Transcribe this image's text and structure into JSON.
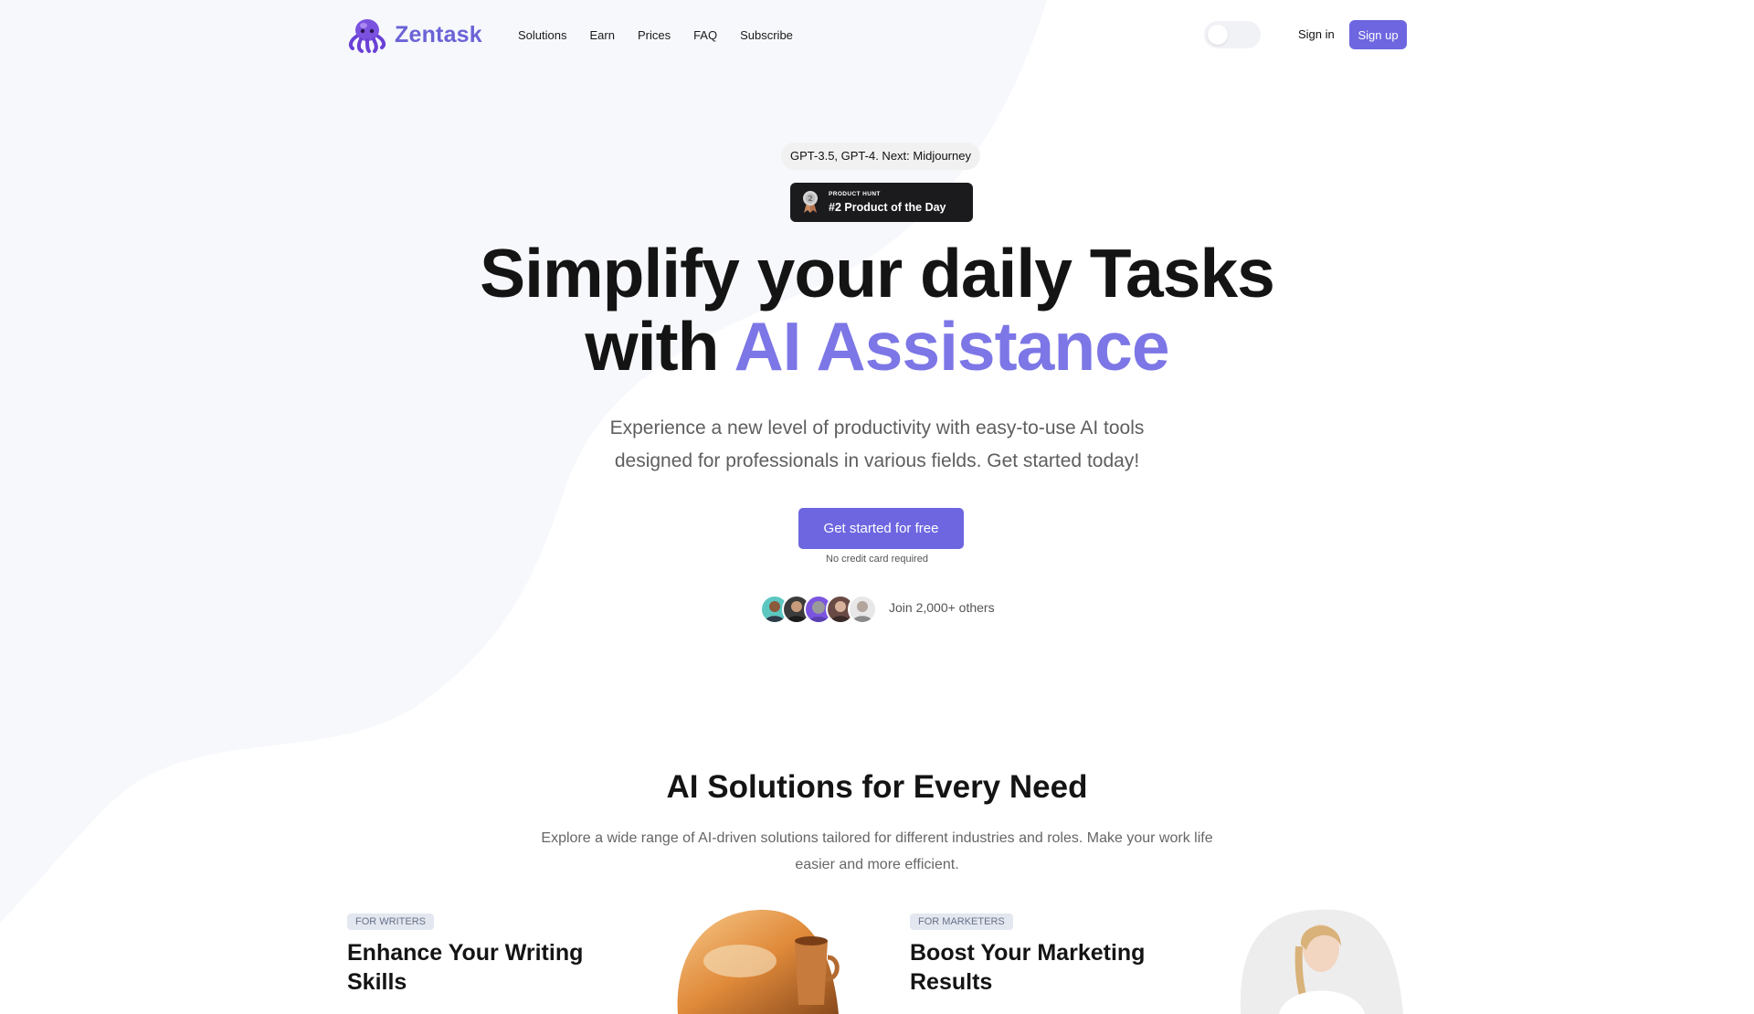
{
  "nav": {
    "brand": "Zentask",
    "links": [
      "Solutions",
      "Earn",
      "Prices",
      "FAQ",
      "Subscribe"
    ],
    "sign_in": "Sign in",
    "sign_up": "Sign up"
  },
  "hero": {
    "models_pill": "GPT-3.5, GPT-4. Next: Midjourney",
    "badge": {
      "kicker": "PRODUCT HUNT",
      "title": "#2 Product of the Day"
    },
    "title_line1": "Simplify your daily Tasks",
    "title_line2_prefix": "with ",
    "title_line2_accent": "AI Assistance",
    "subtitle_line1": "Experience a new level of productivity with easy-to-use AI tools",
    "subtitle_line2": "designed for professionals in various fields. Get started today!",
    "cta": "Get started for free",
    "cta_note": "No credit card required",
    "social_proof": "Join 2,000+ others"
  },
  "solutions": {
    "title": "AI Solutions for Every Need",
    "subtitle_line1": "Explore a wide range of AI-driven solutions tailored for different industries and roles. Make your work life",
    "subtitle_line2": "easier and more efficient.",
    "cards": [
      {
        "tag": "FOR WRITERS",
        "title_line1": "Enhance Your Writing",
        "title_line2": "Skills"
      },
      {
        "tag": "FOR MARKETERS",
        "title_line1": "Boost Your Marketing",
        "title_line2": "Results"
      }
    ]
  },
  "colors": {
    "accent": "#6e66e0",
    "accent_text": "#7c76e6",
    "background_blob": "#f6f8fc"
  },
  "icons": [
    "octopus-logo-icon",
    "award-medal-icon",
    "theme-toggle-icon"
  ]
}
